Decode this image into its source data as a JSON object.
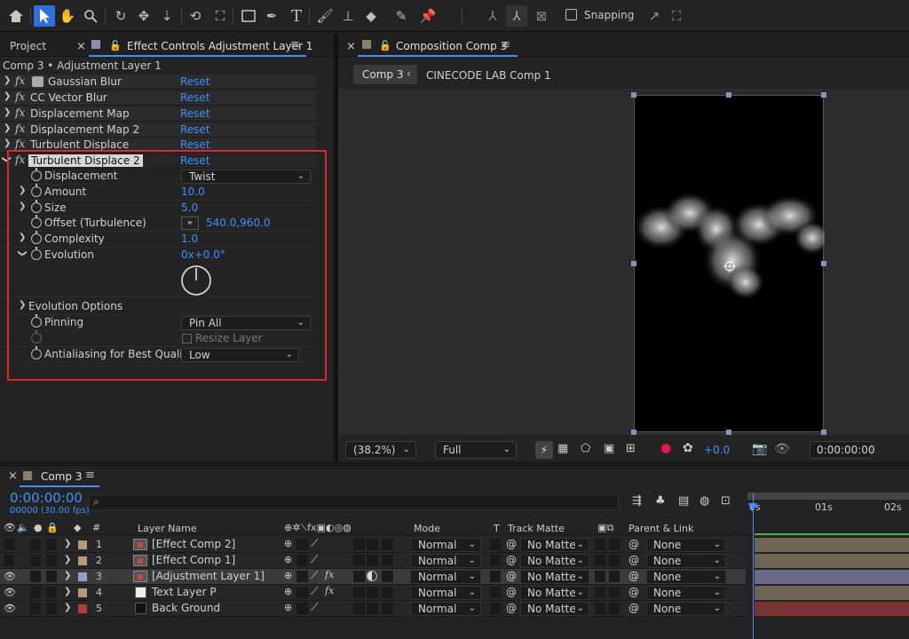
{
  "toolbar": {
    "tools": [
      "home-icon",
      "selection-icon",
      "hand-icon",
      "zoom-icon",
      "orbit-icon",
      "pan-icon",
      "dolly-icon",
      "rotate-icon",
      "anchor-icon",
      "rectangle-icon",
      "pen-icon",
      "type-icon",
      "brush-icon",
      "clone-icon",
      "eraser-icon",
      "roto-icon",
      "puppet-icon"
    ],
    "snapping_label": "Snapping"
  },
  "left_panel": {
    "tab_project": "Project",
    "tab_effect_controls": "Effect Controls Adjustment Layer 1",
    "breadcrumb": "Comp 3 • Adjustment Layer 1",
    "effects": [
      {
        "name": "Gaussian Blur",
        "reset": "Reset"
      },
      {
        "name": "CC Vector Blur",
        "reset": "Reset"
      },
      {
        "name": "Displacement Map",
        "reset": "Reset"
      },
      {
        "name": "Displacement Map 2",
        "reset": "Reset"
      },
      {
        "name": "Turbulent Displace",
        "reset": "Reset"
      },
      {
        "name": "Turbulent Displace 2",
        "reset": "Reset"
      }
    ],
    "props": {
      "displacement": {
        "label": "Displacement",
        "value": "Twist"
      },
      "amount": {
        "label": "Amount",
        "value": "10.0"
      },
      "size": {
        "label": "Size",
        "value": "5.0"
      },
      "offset": {
        "label": "Offset (Turbulence)",
        "value": "540.0,960.0"
      },
      "complexity": {
        "label": "Complexity",
        "value": "1.0"
      },
      "evolution": {
        "label": "Evolution",
        "value": "0x+0.0°"
      },
      "evolution_options": {
        "label": "Evolution Options"
      },
      "pinning": {
        "label": "Pinning",
        "value": "Pin All"
      },
      "resize_layer": {
        "label": "Resize Layer"
      },
      "antialiasing": {
        "label": "Antialiasing for Best Quality",
        "value": "Low"
      }
    }
  },
  "comp_panel": {
    "tab_title": "Composition Comp 3",
    "flow_tab_active": "Comp 3",
    "flow_tab_other": "CINECODE LAB Comp 1",
    "zoom": "(38.2%)",
    "resolution": "Full",
    "exposure": "+0.0",
    "timecode": "0:00:00:00"
  },
  "timeline": {
    "tab_title": "Comp 3",
    "timecode": "0:00:00:00",
    "frames": "00000 (30.00 fps)",
    "search_placeholder": "",
    "headers": {
      "layer_name": "Layer Name",
      "mode": "Mode",
      "t": "T",
      "track_matte": "Track Matte",
      "parent_link": "Parent & Link"
    },
    "ruler": [
      "0s",
      "01s",
      "02s"
    ],
    "layers": [
      {
        "num": "1",
        "name": "[Effect Comp 2]",
        "mode": "Normal",
        "matte": "No Matte",
        "parent": "None",
        "label_color": "#b29a7a",
        "bar_color": "#6e6555"
      },
      {
        "num": "2",
        "name": "[Effect Comp 1]",
        "mode": "Normal",
        "matte": "No Matte",
        "parent": "None",
        "label_color": "#b29a7a",
        "bar_color": "#6e6555"
      },
      {
        "num": "3",
        "name": "[Adjustment Layer 1]",
        "mode": "Normal",
        "matte": "No Matte",
        "parent": "None",
        "label_color": "#9a9ac8",
        "bar_color": "#6a6a86"
      },
      {
        "num": "4",
        "name": "Text Layer P",
        "mode": "Normal",
        "matte": "No Matte",
        "parent": "None",
        "label_color": "#b29a7a",
        "bar_color": "#6e6555"
      },
      {
        "num": "5",
        "name": "Back Ground",
        "mode": "Normal",
        "matte": "No Matte",
        "parent": "None",
        "label_color": "#b33a3a",
        "bar_color": "#7a3434"
      }
    ]
  }
}
